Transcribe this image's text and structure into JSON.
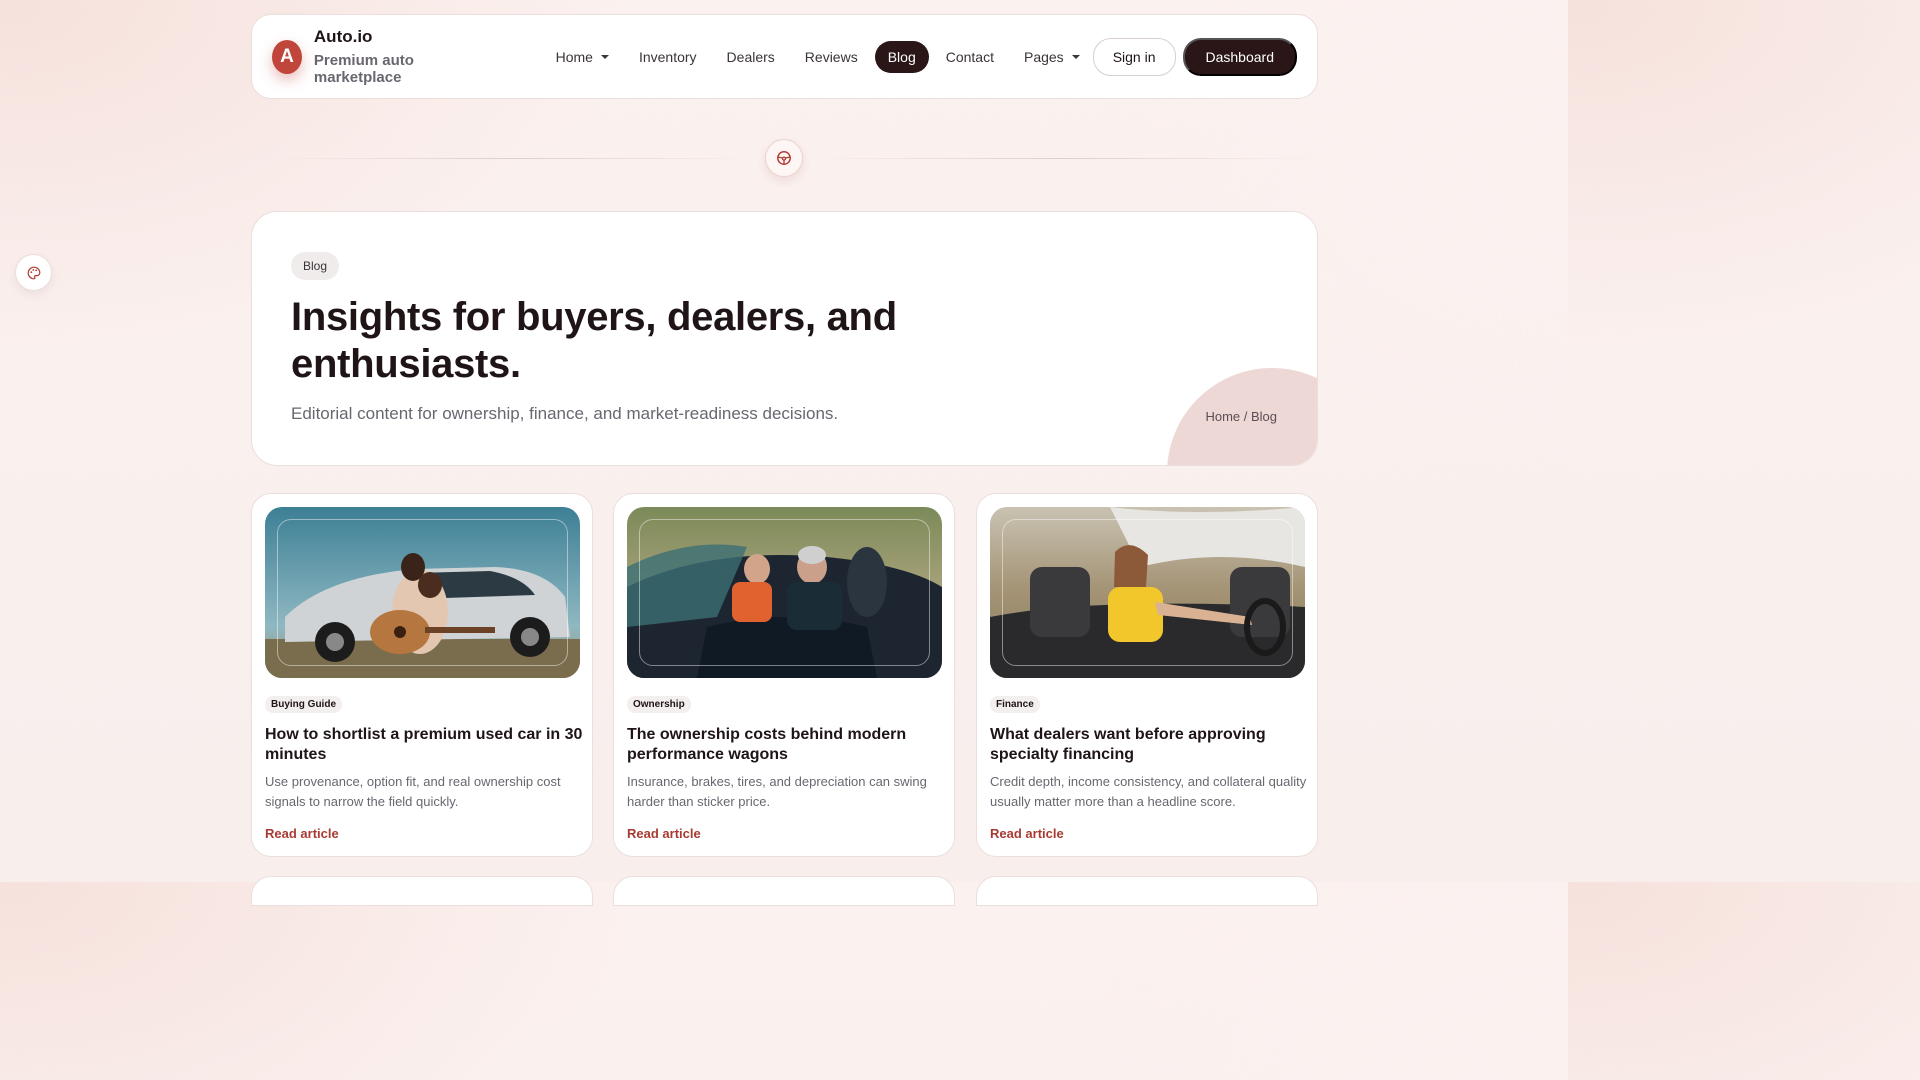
{
  "brand": {
    "initial": "A",
    "name": "Auto.io",
    "tagline": "Premium auto marketplace"
  },
  "nav": {
    "items": [
      {
        "label": "Home",
        "dropdown": true
      },
      {
        "label": "Inventory"
      },
      {
        "label": "Dealers"
      },
      {
        "label": "Reviews"
      },
      {
        "label": "Blog",
        "active": true
      },
      {
        "label": "Contact"
      },
      {
        "label": "Pages",
        "dropdown": true
      }
    ],
    "sign_in": "Sign in",
    "dashboard": "Dashboard"
  },
  "icons": {
    "divider": "steering-wheel-icon",
    "side": "palette-icon"
  },
  "hero": {
    "pill": "Blog",
    "title": "Insights for buyers, dealers, and enthusiasts.",
    "subtitle": "Editorial content for ownership, finance, and market-readiness decisions.",
    "breadcrumb": "Home / Blog"
  },
  "articles": [
    {
      "tag": "Buying Guide",
      "title": "How to shortlist a premium used car in 30 minutes",
      "description": "Use provenance, option fit, and real ownership cost signals to narrow the field quickly.",
      "link": "Read article"
    },
    {
      "tag": "Ownership",
      "title": "The ownership costs behind modern performance wagons",
      "description": "Insurance, brakes, tires, and depreciation can swing harder than sticker price.",
      "link": "Read article"
    },
    {
      "tag": "Finance",
      "title": "What dealers want before approving specialty financing",
      "description": "Credit depth, income consistency, and collateral quality usually matter more than a headline score.",
      "link": "Read article"
    }
  ],
  "colors": {
    "accent": "#c0453b",
    "dark": "#2a1517",
    "link": "#a83a33"
  }
}
